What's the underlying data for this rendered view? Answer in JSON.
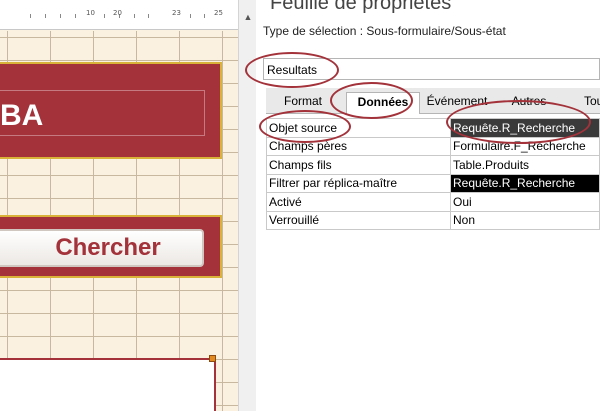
{
  "ruler": {
    "marks": [
      "10",
      "20",
      "23",
      "25"
    ]
  },
  "design": {
    "header_title": "BA",
    "search_button_label": "Chercher"
  },
  "property_sheet": {
    "title": "Feuille de propriétés",
    "selection_type": "Type de sélection : Sous-formulaire/Sous-état",
    "object_name": "Resultats",
    "tabs": [
      {
        "label": "Format",
        "active": false
      },
      {
        "label": "Données",
        "active": true
      },
      {
        "label": "Événement",
        "active": false
      },
      {
        "label": "Autres",
        "active": false
      },
      {
        "label": "Tou",
        "active": false
      }
    ],
    "rows": [
      {
        "name": "Objet source",
        "value": "Requête.R_Recherche"
      },
      {
        "name": "Champs pères",
        "value": "Formulaire.F_Recherche"
      },
      {
        "name": "Champs fils",
        "value": "Table.Produits"
      },
      {
        "name": "Filtrer par réplica-maître",
        "value": "Requête.R_Recherche"
      },
      {
        "name": "Activé",
        "value": "Oui"
      },
      {
        "name": "Verrouillé",
        "value": "Non"
      }
    ]
  },
  "colors": {
    "accent": "#a3323a",
    "gold": "#d9b23a",
    "canvas": "#fbf1e0"
  },
  "icons": {
    "scroll_up": "chevron-up-icon"
  }
}
